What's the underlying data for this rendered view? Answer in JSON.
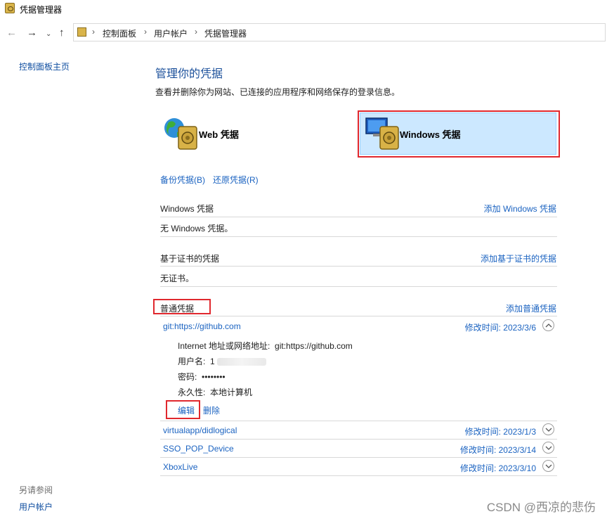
{
  "window": {
    "title": "凭据管理器"
  },
  "address": {
    "crumbs": [
      "控制面板",
      "用户帐户",
      "凭据管理器"
    ]
  },
  "sidebar": {
    "home_link": "控制面板主页",
    "see_also_heading": "另请参阅",
    "user_accounts_link": "用户帐户"
  },
  "main": {
    "title": "管理你的凭据",
    "subtitle": "查看并删除你为网站、已连接的应用程序和网络保存的登录信息。",
    "web_card_label": "Web 凭据",
    "windows_card_label": "Windows 凭据",
    "backup_link": "备份凭据(B)",
    "restore_link": "还原凭据(R)"
  },
  "sections": {
    "windows": {
      "title": "Windows 凭据",
      "add_link": "添加 Windows 凭据",
      "empty_text": "无 Windows 凭据。"
    },
    "certificate": {
      "title": "基于证书的凭据",
      "add_link": "添加基于证书的凭据",
      "empty_text": "无证书。"
    },
    "generic": {
      "title": "普通凭据",
      "add_link": "添加普通凭据"
    }
  },
  "credentials": [
    {
      "name": "git:https://github.com",
      "modified": "修改时间:  2023/3/6",
      "expanded": true
    },
    {
      "name": "virtualapp/didlogical",
      "modified": "修改时间:  2023/1/3",
      "expanded": false
    },
    {
      "name": "SSO_POP_Device",
      "modified": "修改时间:  2023/3/14",
      "expanded": false
    },
    {
      "name": "XboxLive",
      "modified": "修改时间:  2023/3/10",
      "expanded": false
    }
  ],
  "details": {
    "address_label": "Internet 地址或网络地址:",
    "address_value": "git:https://github.com",
    "username_label": "用户名:",
    "username_value": "1",
    "password_label": "密码:",
    "password_value": "••••••••",
    "persistence_label": "永久性:",
    "persistence_value": "本地计算机",
    "edit_link": "编辑",
    "delete_link": "删除"
  },
  "watermark": "CSDN @西凉的悲伤",
  "colors": {
    "link": "#1b63c1",
    "heading": "#1a4f9a",
    "highlight": "#cce8ff",
    "annotation": "#e0282e"
  }
}
